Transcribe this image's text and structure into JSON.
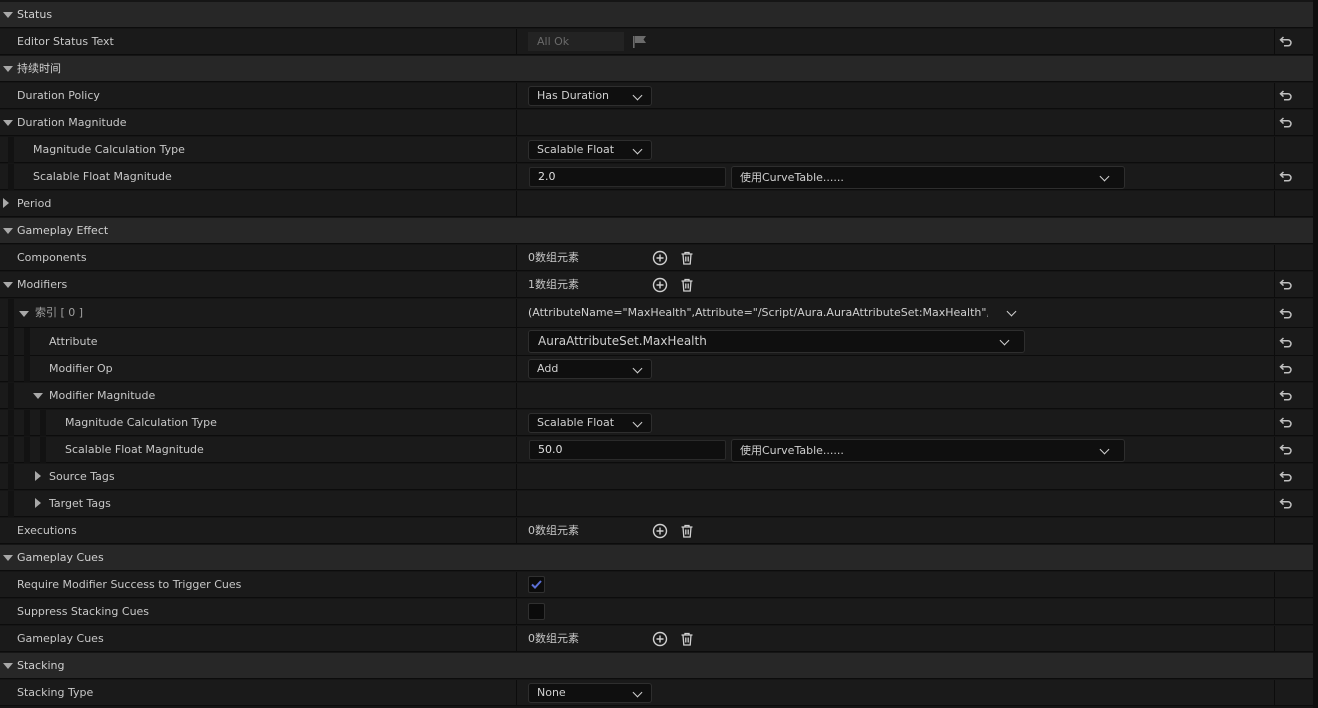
{
  "colors": {
    "category_bg": "#272727",
    "row_bg": "#1a1a1a",
    "accent_check": "#5b6fd6"
  },
  "rows": {
    "status": {
      "label": "Status"
    },
    "editor_status_text": {
      "label": "Editor Status Text",
      "value": "All Ok"
    },
    "duration": {
      "label": "持续时间"
    },
    "duration_policy": {
      "label": "Duration Policy",
      "value": "Has Duration"
    },
    "duration_magnitude": {
      "label": "Duration Magnitude"
    },
    "dm_calc_type": {
      "label": "Magnitude Calculation Type",
      "value": "Scalable Float"
    },
    "dm_scalable": {
      "label": "Scalable Float Magnitude",
      "value": "2.0",
      "curve": "使用CurveTable......"
    },
    "period": {
      "label": "Period"
    },
    "gameplay_effect": {
      "label": "Gameplay Effect"
    },
    "components": {
      "label": "Components",
      "count": "0数组元素"
    },
    "modifiers": {
      "label": "Modifiers",
      "count": "1数组元素"
    },
    "index0": {
      "label": "索引 [ 0 ]",
      "value": "(AttributeName=\"MaxHealth\",Attribute=\"/Script/Aura.AuraAttributeSet:MaxHealth\",AttributeOwner=\"/Script/CoreUObject.Class'/Script/Aura.AuraAttributeSet'\")"
    },
    "attribute": {
      "label": "Attribute",
      "value": "AuraAttributeSet.MaxHealth"
    },
    "modifier_op": {
      "label": "Modifier Op",
      "value": "Add"
    },
    "modifier_magnitude": {
      "label": "Modifier Magnitude"
    },
    "mm_calc_type": {
      "label": "Magnitude Calculation Type",
      "value": "Scalable Float"
    },
    "mm_scalable": {
      "label": "Scalable Float Magnitude",
      "value": "50.0",
      "curve": "使用CurveTable......"
    },
    "source_tags": {
      "label": "Source Tags"
    },
    "target_tags": {
      "label": "Target Tags"
    },
    "executions": {
      "label": "Executions",
      "count": "0数组元素"
    },
    "gameplay_cues_cat": {
      "label": "Gameplay Cues"
    },
    "require_modifier_success": {
      "label": "Require Modifier Success to Trigger Cues",
      "checked": true
    },
    "suppress_stacking": {
      "label": "Suppress Stacking Cues",
      "checked": false
    },
    "gameplay_cues": {
      "label": "Gameplay Cues",
      "count": "0数组元素"
    },
    "stacking": {
      "label": "Stacking"
    },
    "stacking_type": {
      "label": "Stacking Type",
      "value": "None"
    }
  },
  "icons": {
    "reset": "reset-arrow-icon",
    "add": "add-circle-icon",
    "delete": "trash-icon",
    "flag": "flag-icon"
  }
}
